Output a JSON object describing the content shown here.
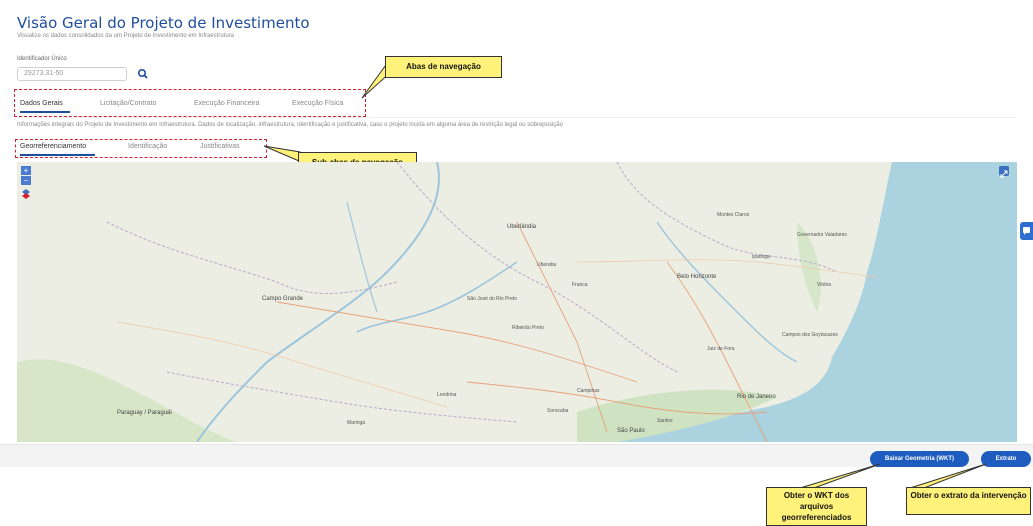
{
  "header": {
    "title": "Visão Geral do Projeto de Investimento",
    "subtitle": "Visualize os dados consolidados da um Projeto de Investimento em Infraestrutura"
  },
  "search": {
    "label": "Identificador Único",
    "value": "29273.31-50"
  },
  "tabs": [
    {
      "label": "Dados Gerais",
      "active": true
    },
    {
      "label": "Licitação/Contrato",
      "active": false
    },
    {
      "label": "Execução Financeira",
      "active": false
    },
    {
      "label": "Execução Física",
      "active": false
    }
  ],
  "info_text": "Informações integrais do Projeto de Investimento em Infraestrutura. Dados de localização, infraestrutura, identificação e justificativa, caso o projeto incida em alguma área de restrição legal ou sobreposição",
  "subtabs": [
    {
      "label": "Georreferenciamento",
      "active": true
    },
    {
      "label": "Identificação",
      "active": false
    },
    {
      "label": "Justificativas",
      "active": false
    }
  ],
  "callouts": {
    "tabs": "Abas de navegação",
    "subtabs": "Sub-abas de navegação",
    "wkt": "Obter o WKT dos arquivos georreferenciados",
    "extract": "Obter o extrato da intervenção"
  },
  "map": {
    "controls": [
      "+",
      "−"
    ],
    "labels": {
      "campo_grande": "Campo Grande",
      "uberlandia": "Uberlândia",
      "belo_horizonte": "Belo Horizonte",
      "vitoria": "Vitória",
      "ribeirao_preto": "Ribeirão Preto",
      "sao_jose": "São José do Rio Preto",
      "campinas": "Campinas",
      "sao_paulo": "São Paulo",
      "rio": "Rio de Janeiro",
      "juiz_de_fora": "Juiz de Fora",
      "maringa": "Maringá",
      "paraguay": "Paraguay / Paraguái",
      "montes_claros": "Montes Claros",
      "campos": "Campos dos Goytacazes",
      "londrina": "Londrina",
      "uberaba": "Uberaba",
      "franca": "Franca",
      "ipatinga": "Ipatinga",
      "governador": "Governador Valadares",
      "sorocaba": "Sorocaba",
      "santos": "Santos"
    }
  },
  "footer": {
    "wkt_button": "Baixar Geometria (WKT)",
    "extract_button": "Extrato"
  },
  "colors": {
    "primary": "#1f5cbf",
    "title": "#1e4f9c",
    "highlight_dash": "#d2202f",
    "callout_bg": "#fff27a"
  }
}
